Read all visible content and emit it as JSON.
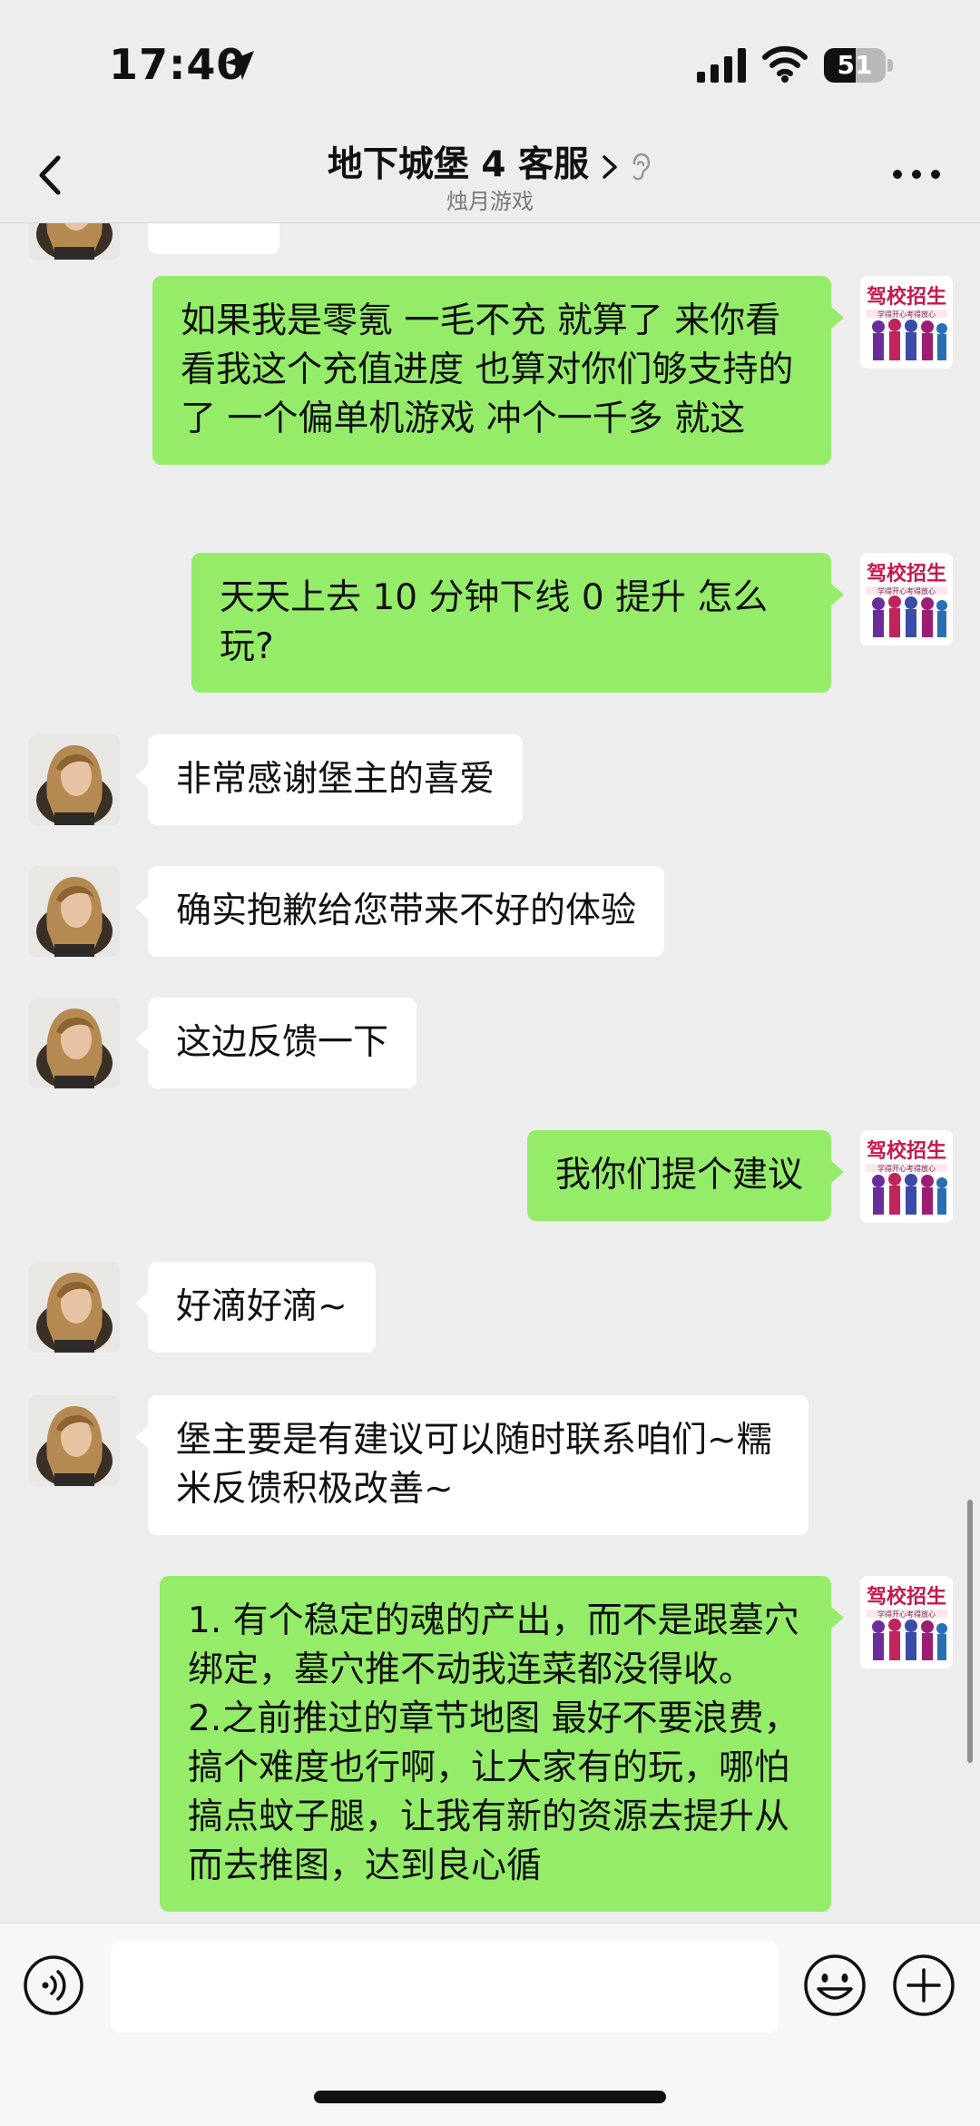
{
  "status_bar": {
    "time": "17:40",
    "battery": "51",
    "battery_level": 0.51
  },
  "header": {
    "title": "地下城堡 4 客服",
    "subtitle": "烛月游戏"
  },
  "messages": [
    {
      "side": "in",
      "text": ""
    },
    {
      "side": "out",
      "text": "如果我是零氪 一毛不充 就算了 来你看看我这个充值进度 也算对你们够支持的了 一个偏单机游戏 冲个一千多 就这"
    },
    {
      "side": "out",
      "text": "天天上去 10 分钟下线 0 提升 怎么玩?"
    },
    {
      "side": "in",
      "text": "非常感谢堡主的喜爱"
    },
    {
      "side": "in",
      "text": "确实抱歉给您带来不好的体验"
    },
    {
      "side": "in",
      "text": "这边反馈一下"
    },
    {
      "side": "out",
      "text": "我你们提个建议"
    },
    {
      "side": "in",
      "text": "好滴好滴~"
    },
    {
      "side": "in",
      "text": "堡主要是有建议可以随时联系咱们~糯米反馈积极改善~"
    },
    {
      "side": "out",
      "text": "1. 有个稳定的魂的产出，而不是跟墓穴绑定，墓穴推不动我连菜都没得收。\n2.之前推过的章节地图 最好不要浪费，搞个难度也行啊，让大家有的玩，哪怕搞点蚊子腿，让我有新的资源去提升从而去推图，达到良心循"
    }
  ],
  "self_avatar": {
    "line1": "驾校招生",
    "line2": "学得开心考得放心"
  },
  "colors": {
    "bubble_out": "#95ec69",
    "bubble_in": "#ffffff",
    "background": "#ededed"
  },
  "input": {
    "placeholder": ""
  }
}
